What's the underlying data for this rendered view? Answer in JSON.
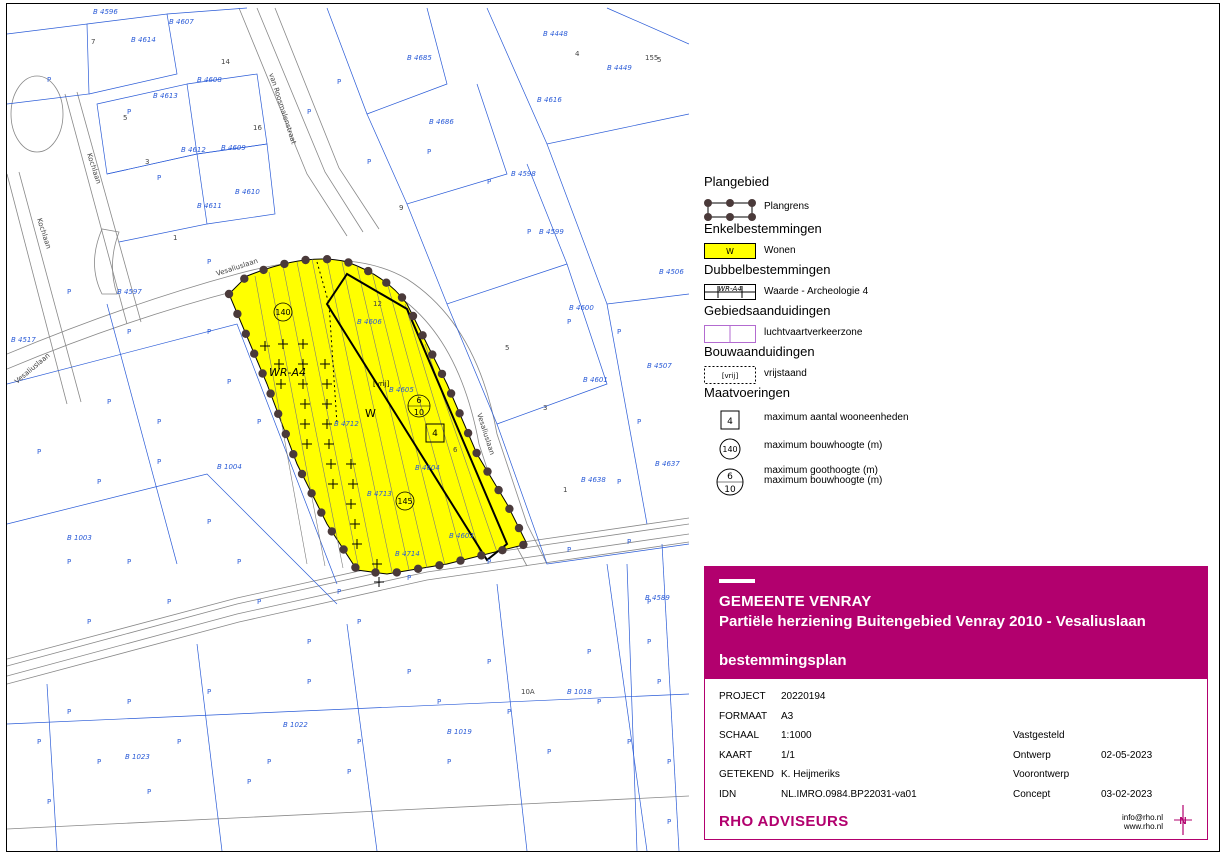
{
  "map": {
    "parcels": [
      "B 4596",
      "B 4607",
      "B 4614",
      "B 4608",
      "B 4613",
      "B 4612",
      "B 4609",
      "B 4611",
      "B 4610",
      "B 4597",
      "B 4685",
      "B 4686",
      "B 4448",
      "B 4449",
      "B 4616",
      "B 4598",
      "B 4599",
      "B 4506",
      "B 4600",
      "B 4507",
      "B 4601",
      "B 4637",
      "B 4638",
      "B 4606",
      "B 4605",
      "B 4604",
      "B 4603",
      "B 4712",
      "B 4713",
      "B 4714",
      "B 1004",
      "B 1003",
      "B 1022",
      "B 1023",
      "B 1019",
      "B 1018",
      "B 4517",
      "B 4589"
    ],
    "houses": [
      "7",
      "14",
      "5",
      "16",
      "3",
      "1",
      "9",
      "5",
      "3",
      "1",
      "12",
      "6",
      "5",
      "4",
      "155",
      "10A"
    ],
    "streets": [
      "Kochlaan",
      "Kochlaan",
      "Vesaliuslaan",
      "Vesaliuslaan",
      "Vesaliuslaan",
      "van Roosmalenstraat"
    ],
    "plan": {
      "max_height_label": "140",
      "archeo_label": "WR-A4",
      "bouw_label": "[vrij]",
      "wonen_label": "W",
      "goot_value": "6",
      "bouw_value": "10",
      "max_height_2": "145",
      "max_units": "4"
    },
    "p_mark": "P"
  },
  "legend": {
    "sections": [
      {
        "title": "Plangebied",
        "items": [
          {
            "label": "Plangrens",
            "symbol": "plangrens"
          }
        ]
      },
      {
        "title": "Enkelbestemmingen",
        "items": [
          {
            "label": "Wonen",
            "symbol": "wonen",
            "code": "W"
          }
        ]
      },
      {
        "title": "Dubbelbestemmingen",
        "items": [
          {
            "label": "Waarde - Archeologie 4",
            "symbol": "archeo",
            "code": "WR-A4"
          }
        ]
      },
      {
        "title": "Gebiedsaanduidingen",
        "items": [
          {
            "label": "luchtvaartverkeerzone",
            "symbol": "lucht"
          }
        ]
      },
      {
        "title": "Bouwaanduidingen",
        "items": [
          {
            "label": "vrijstaand",
            "symbol": "vrij",
            "code": "[vrij]"
          }
        ]
      },
      {
        "title": "Maatvoeringen",
        "items": [
          {
            "label": "maximum aantal wooneenheden",
            "symbol": "square",
            "code": "4"
          },
          {
            "label": "maximum bouwhoogte (m)",
            "symbol": "circle",
            "code": "140"
          },
          {
            "label": "maximum goothoogte (m)",
            "label2": "maximum bouwhoogte (m)",
            "symbol": "circle2",
            "code": "6",
            "code2": "10"
          }
        ]
      }
    ]
  },
  "colors": {
    "brand": "#b2006e",
    "wonen": "#ffff00",
    "cadastre": "#2a5bd7",
    "lucht": "#b36bd0"
  },
  "cartouche": {
    "gemeente": "GEMEENTE VENRAY",
    "title": "Partiële herziening Buitengebied Venray 2010 - Vesaliuslaan",
    "type": "bestemmingsplan",
    "fields": [
      {
        "key": "PROJECT",
        "value": "20220194"
      },
      {
        "key": "FORMAAT",
        "value": "A3"
      },
      {
        "key": "SCHAAL",
        "value": "1:1000"
      },
      {
        "key": "KAART",
        "value": "1/1"
      },
      {
        "key": "GETEKEND",
        "value": "K. Heijmeriks"
      },
      {
        "key": "IDN",
        "value": "NL.IMRO.0984.BP22031-va01"
      }
    ],
    "status": [
      {
        "key": "Vastgesteld",
        "value": ""
      },
      {
        "key": "Ontwerp",
        "value": "02-05-2023"
      },
      {
        "key": "Voorontwerp",
        "value": ""
      },
      {
        "key": "Concept",
        "value": "03-02-2023"
      }
    ],
    "logo": "RHO ADVISEURS",
    "email": "info@rho.nl",
    "web": "www.rho.nl",
    "north": "N"
  }
}
